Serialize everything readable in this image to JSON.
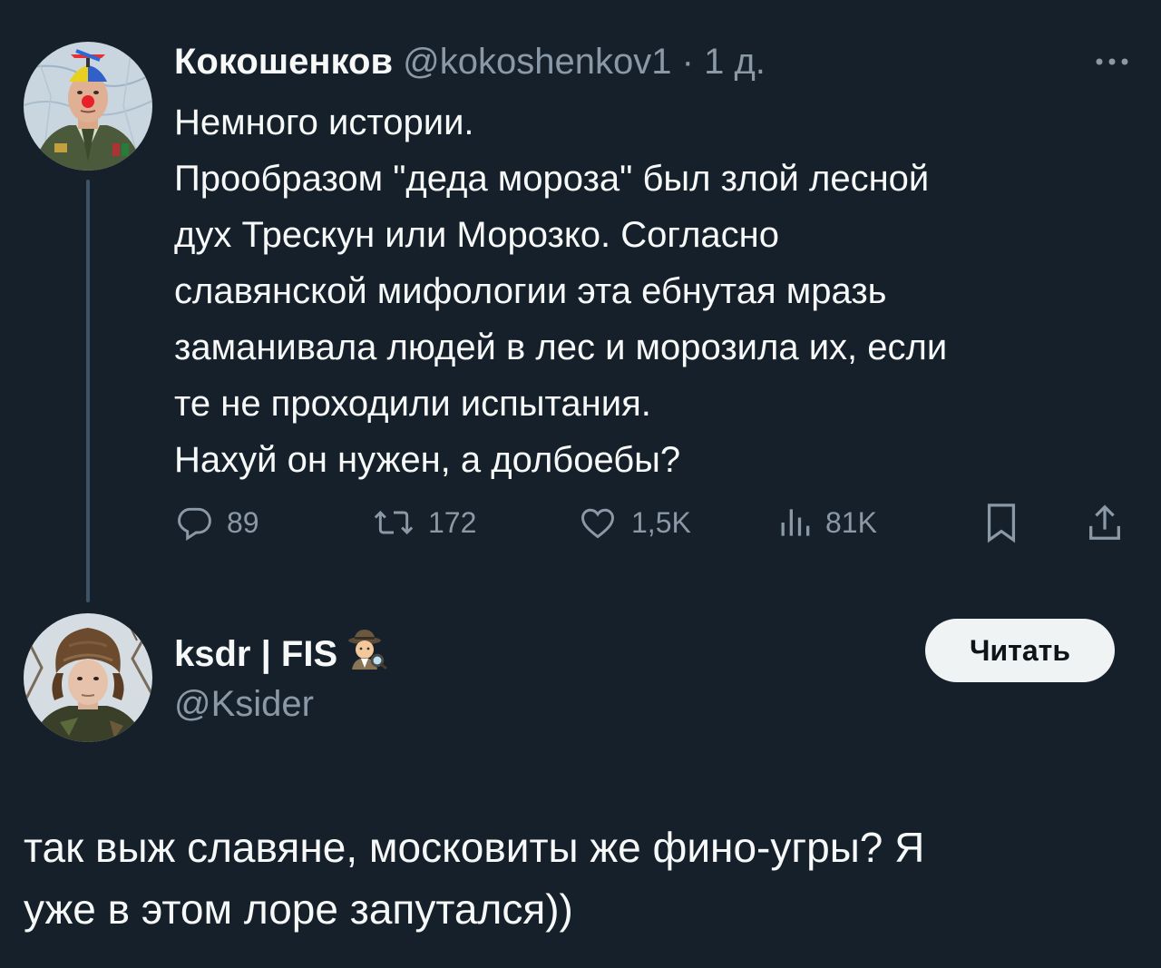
{
  "tweet": {
    "display_name": "Кокошенков",
    "handle": "@kokoshenkov1",
    "separator": "·",
    "time": "1 д.",
    "text_lines": [
      "Немного истории.",
      "Прообразом \"деда мороза\" был злой лесной",
      "дух Трескун или Морозко. Согласно",
      "славянской мифологии эта ебнутая мразь",
      "заманивала людей в лес и морозила их, если",
      "те не проходили испытания.",
      "Нахуй он нужен, а долбоебы?"
    ],
    "actions": {
      "replies": "89",
      "retweets": "172",
      "likes": "1,5K",
      "views": "81K"
    },
    "icons": [
      "reply-icon",
      "retweet-icon",
      "like-icon",
      "views-icon",
      "bookmark-icon",
      "share-icon",
      "more-icon"
    ]
  },
  "reply": {
    "display_name": "ksdr | FIS",
    "emoji": "detective-emoji",
    "handle": "@Ksider",
    "follow_label": "Читать",
    "text_lines": [
      "так выж славяне, московиты же фино-угры? Я",
      "уже в этом лоре запутался))"
    ]
  },
  "colors": {
    "background": "#15202b",
    "text": "#f7f9f9",
    "muted": "#8b98a5",
    "thread_line": "#3d5466",
    "button_bg": "#eff3f4"
  }
}
